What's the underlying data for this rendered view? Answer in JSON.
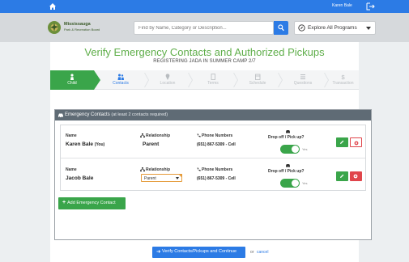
{
  "topbar": {
    "user_name": "Karen Bale"
  },
  "header": {
    "org_name": "Mississauga",
    "org_subname": "Park & Recreation Board",
    "search_placeholder": "Find by Name, Category or Description...",
    "explore_label": "Explore All Programs"
  },
  "page": {
    "title": "Verify Emergency Contacts and Authorized Pickups",
    "subtitle": "REGISTERING JADA IN SUMMER CAMP 2/7"
  },
  "steps": [
    {
      "label": "Child",
      "state": "done"
    },
    {
      "label": "Contacts",
      "state": "active"
    },
    {
      "label": "Location",
      "state": "todo"
    },
    {
      "label": "Terms",
      "state": "todo"
    },
    {
      "label": "Schedule",
      "state": "todo"
    },
    {
      "label": "Questions",
      "state": "todo"
    },
    {
      "label": "Transaction",
      "state": "todo"
    }
  ],
  "panel": {
    "title": "Emergency Contacts",
    "note": "(at least 2 contacts required)",
    "labels": {
      "name": "Name",
      "relationship": "Relationship",
      "phone": "Phone Numbers",
      "dropoff": "Drop off / Pick up?",
      "yes": "Yes"
    },
    "contacts": [
      {
        "name": "Karen Bale",
        "suffix": "(You)",
        "relationship": "Parent",
        "phone": "(651) 867-5309 - Cell",
        "dropoff": true
      },
      {
        "name": "Jacob Bale",
        "suffix": "",
        "relationship_select": "Parent",
        "phone": "(651) 867-5309 - Cell",
        "dropoff": true
      }
    ],
    "add_label": "Add Emergency Contact"
  },
  "footer": {
    "continue_label": "Verify Contacts/Pickups and Continue",
    "or_text": "or",
    "cancel_label": "cancel"
  },
  "colors": {
    "primary": "#2c7be5",
    "success": "#3aa54a",
    "danger": "#e0454b",
    "title_green": "#5fae4a"
  }
}
